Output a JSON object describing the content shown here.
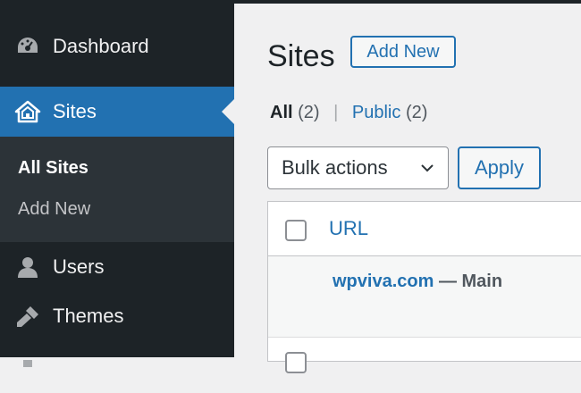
{
  "sidebar": {
    "items": [
      {
        "label": "Dashboard",
        "icon": "dashboard-icon"
      },
      {
        "label": "Sites",
        "icon": "sites-icon",
        "active": true
      },
      {
        "label": "Users",
        "icon": "users-icon"
      },
      {
        "label": "Themes",
        "icon": "themes-icon"
      }
    ],
    "submenu": [
      {
        "label": "All Sites",
        "current": true
      },
      {
        "label": "Add New"
      }
    ]
  },
  "page": {
    "title": "Sites",
    "add_new_label": "Add New"
  },
  "filters": {
    "all_label": "All",
    "all_count": "(2)",
    "separator": "|",
    "public_label": "Public",
    "public_count": "(2)"
  },
  "bulk": {
    "selected": "Bulk actions",
    "apply_label": "Apply"
  },
  "table": {
    "column_url": "URL",
    "rows": [
      {
        "site": "wpviva.com",
        "suffix": " — Main"
      }
    ]
  },
  "colors": {
    "sidebar_bg": "#1d2327",
    "accent": "#2271b1",
    "page_bg": "#f0f0f1"
  }
}
